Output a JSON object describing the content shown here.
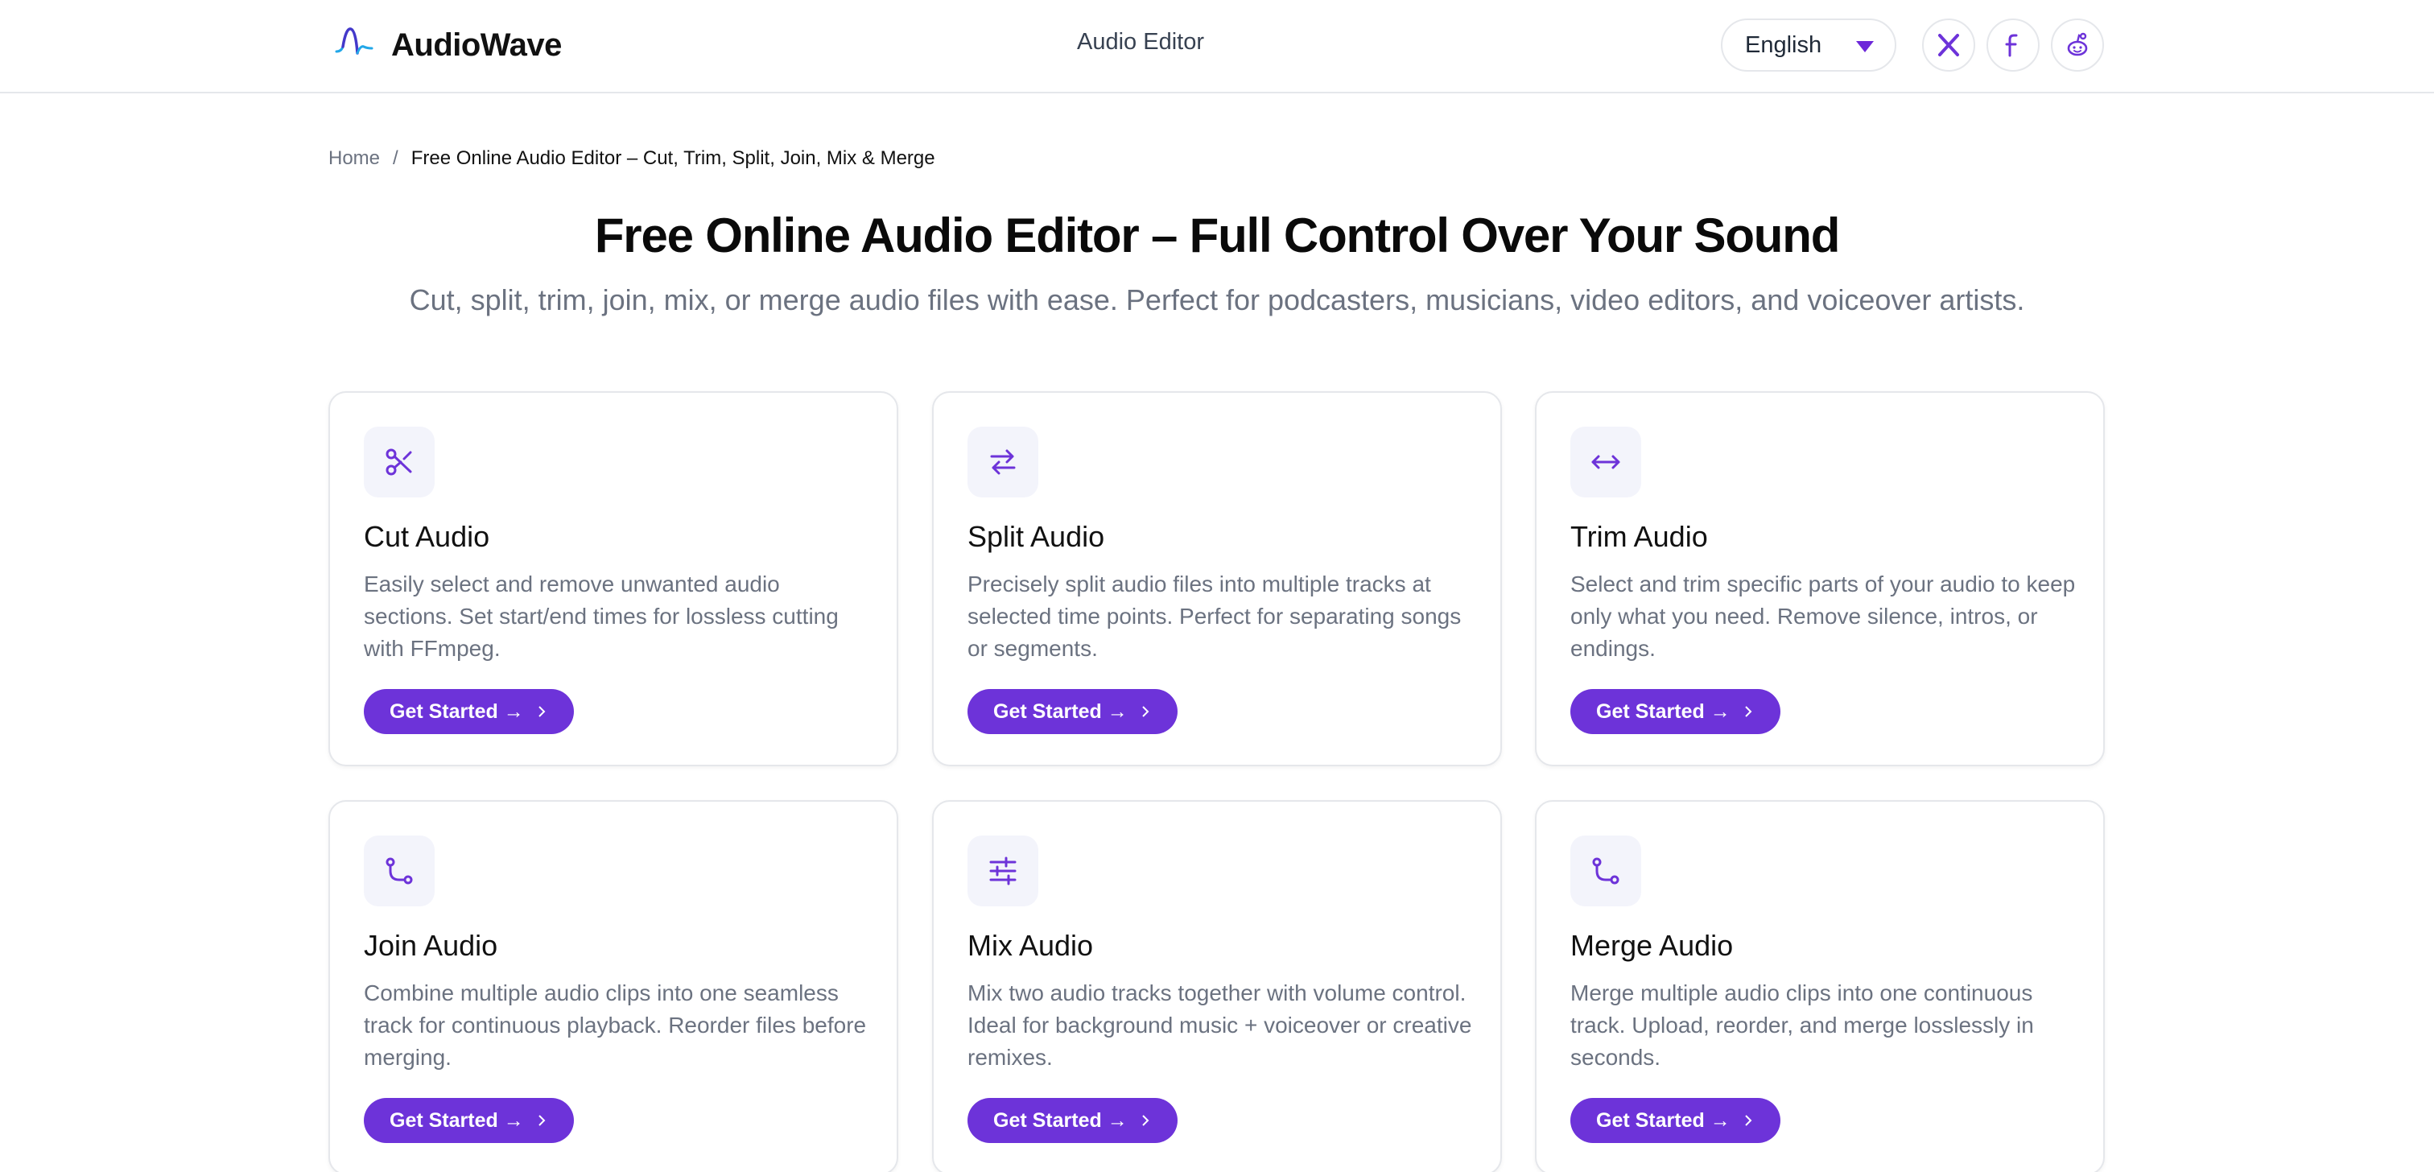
{
  "header": {
    "brand": "AudioWave",
    "nav_link": "Audio Editor",
    "language": "English",
    "accent_color": "#6d33d9"
  },
  "breadcrumb": {
    "home": "Home",
    "separator": "/",
    "current": "Free Online Audio Editor – Cut, Trim, Split, Join, Mix & Merge"
  },
  "hero": {
    "title": "Free Online Audio Editor – Full Control Over Your Sound",
    "subtitle": "Cut, split, trim, join, mix, or merge audio files with ease. Perfect for podcasters, musicians, video editors, and voiceover artists."
  },
  "cards": [
    {
      "icon": "scissors-icon",
      "title": "Cut Audio",
      "desc": "Easily select and remove unwanted audio sections. Set start/end times for lossless cutting with FFmpeg.",
      "button": "Get Started →"
    },
    {
      "icon": "split-arrows-icon",
      "title": "Split Audio",
      "desc": "Precisely split audio files into multiple tracks at selected time points. Perfect for separating songs or segments.",
      "button": "Get Started →"
    },
    {
      "icon": "trim-arrows-icon",
      "title": "Trim Audio",
      "desc": "Select and trim specific parts of your audio to keep only what you need. Remove silence, intros, or endings.",
      "button": "Get Started →"
    },
    {
      "icon": "route-icon",
      "title": "Join Audio",
      "desc": "Combine multiple audio clips into one seamless track for continuous playback. Reorder files before merging.",
      "button": "Get Started →"
    },
    {
      "icon": "sliders-icon",
      "title": "Mix Audio",
      "desc": "Mix two audio tracks together with volume control. Ideal for background music + voiceover or creative remixes.",
      "button": "Get Started →"
    },
    {
      "icon": "route-icon",
      "title": "Merge Audio",
      "desc": "Merge multiple audio clips into one continuous track. Upload, reorder, and merge losslessly in seconds.",
      "button": "Get Started →"
    }
  ]
}
